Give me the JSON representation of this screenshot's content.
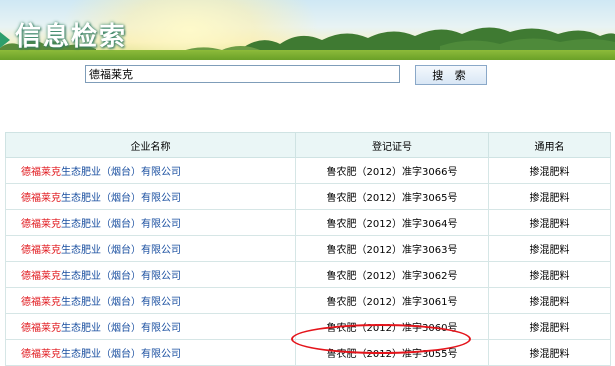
{
  "banner": {
    "title": "信息检索"
  },
  "search": {
    "value": "德福莱克",
    "button_label": "搜 索"
  },
  "table": {
    "headers": [
      "企业名称",
      "登记证号",
      "通用名"
    ],
    "rows": [
      {
        "company_highlight": "德福莱克",
        "company_rest": "生态肥业（烟台）有限公司",
        "reg_no": "鲁农肥（2012）准字3066号",
        "common_name": "掺混肥料"
      },
      {
        "company_highlight": "德福莱克",
        "company_rest": "生态肥业（烟台）有限公司",
        "reg_no": "鲁农肥（2012）准字3065号",
        "common_name": "掺混肥料"
      },
      {
        "company_highlight": "德福莱克",
        "company_rest": "生态肥业（烟台）有限公司",
        "reg_no": "鲁农肥（2012）准字3064号",
        "common_name": "掺混肥料"
      },
      {
        "company_highlight": "德福莱克",
        "company_rest": "生态肥业（烟台）有限公司",
        "reg_no": "鲁农肥（2012）准字3063号",
        "common_name": "掺混肥料"
      },
      {
        "company_highlight": "德福莱克",
        "company_rest": "生态肥业（烟台）有限公司",
        "reg_no": "鲁农肥（2012）准字3062号",
        "common_name": "掺混肥料"
      },
      {
        "company_highlight": "德福莱克",
        "company_rest": "生态肥业（烟台）有限公司",
        "reg_no": "鲁农肥（2012）准字3061号",
        "common_name": "掺混肥料"
      },
      {
        "company_highlight": "德福莱克",
        "company_rest": "生态肥业（烟台）有限公司",
        "reg_no": "鲁农肥（2012）准字3060号",
        "common_name": "掺混肥料"
      },
      {
        "company_highlight": "德福莱克",
        "company_rest": "生态肥业（烟台）有限公司",
        "reg_no": "鲁农肥（2012）准字3055号",
        "common_name": "掺混肥料"
      }
    ]
  },
  "colors": {
    "highlight": "#e0161b",
    "link": "#1a4fa0",
    "annotation": "#e4141b",
    "header_bg": "#eaf6f6"
  }
}
